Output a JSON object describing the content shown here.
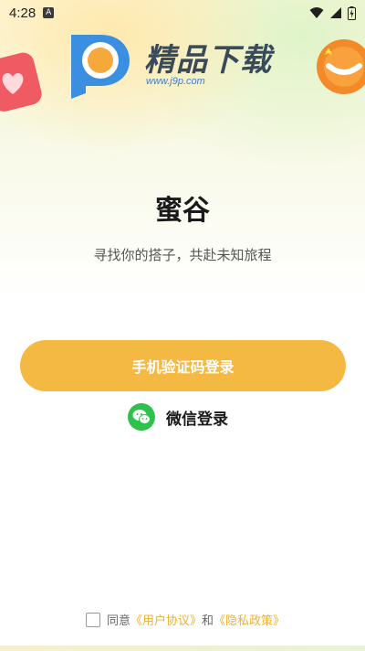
{
  "status_bar": {
    "time": "4:28",
    "notification_icon": "a-notification-icon",
    "icons": [
      "wifi-icon",
      "signal-icon",
      "battery-icon"
    ]
  },
  "logo": {
    "brand": "精品下载",
    "url": "www.j9p.com"
  },
  "app": {
    "title": "蜜谷",
    "tagline": "寻找你的搭子，共赴未知旅程"
  },
  "actions": {
    "phone_login": "手机验证码登录",
    "wechat_login": "微信登录"
  },
  "agreement": {
    "prefix": "同意",
    "user_agreement": "《用户协议》",
    "and": "和",
    "privacy_policy": "《隐私政策》",
    "checked": false
  },
  "colors": {
    "accent": "#f4b942",
    "wechat": "#2dc24a",
    "link": "#f0b12e"
  }
}
